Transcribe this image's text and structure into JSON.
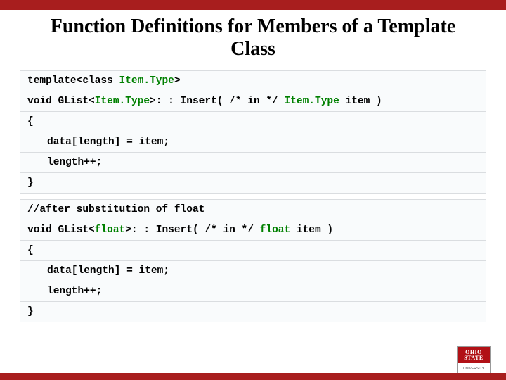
{
  "title": "Function Definitions for Members of a Template Class",
  "block1": {
    "line1_pre": "template<class ",
    "line1_type": "Item.Type",
    "line1_post": ">",
    "line2_pre": "void GList<",
    "line2_type": "Item.Type",
    "line2_mid": ">: : Insert( /* in */ ",
    "line2_type2": "Item.Type",
    "line2_post": " item )",
    "line3": "{",
    "line4": "data[length] = item;",
    "line5": "length++;",
    "line6": "}"
  },
  "block2": {
    "comment": "//after substitution of float",
    "line2_pre": "void GList<",
    "line2_type": "float",
    "line2_mid": ">: : Insert( /* in */ ",
    "line2_type2": "float",
    "line2_post": " item )",
    "line3": "{",
    "line4": "data[length] = item;",
    "line5": "length++;",
    "line6": "}"
  },
  "logo": {
    "top": "OHIO\nSTATE",
    "bottom": "UNIVERSITY"
  }
}
